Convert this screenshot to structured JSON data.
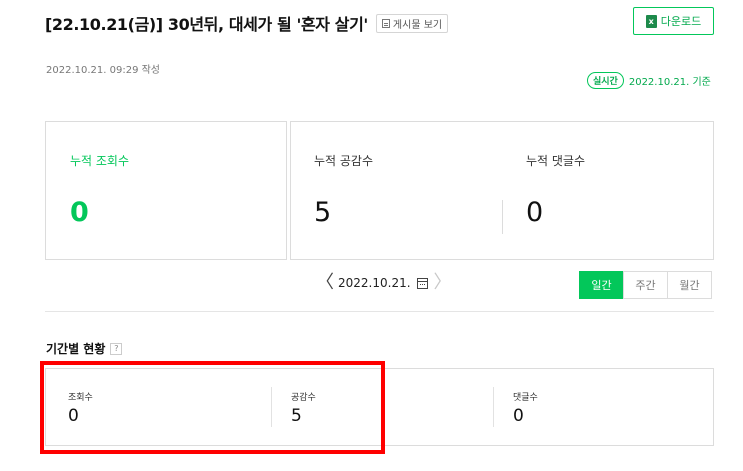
{
  "header": {
    "title": "[22.10.21(금)] 30년뒤, 대세가 될 '혼자 살기'",
    "view_post_label": "게시물 보기",
    "download_label": "다운로드",
    "excel_icon_text": "x"
  },
  "meta": {
    "written_date": "2022.10.21. 09:29 작성",
    "realtime_badge": "실시간",
    "basis_date": "2022.10.21. 기준"
  },
  "summary": {
    "views_label": "누적 조회수",
    "views_value": "0",
    "likes_label": "누적 공감수",
    "likes_value": "5",
    "comments_label": "누적 댓글수",
    "comments_value": "0"
  },
  "date_nav": {
    "prev": "〈",
    "date": "2022.10.21.",
    "next": "〉"
  },
  "period_tabs": [
    "일간",
    "주간",
    "월간"
  ],
  "period_section": {
    "title": "기간별 현황",
    "help": "?",
    "items": [
      {
        "label": "조회수",
        "value": "0"
      },
      {
        "label": "공감수",
        "value": "5"
      },
      {
        "label": "댓글수",
        "value": "0"
      }
    ]
  },
  "colors": {
    "accent": "#03c75a",
    "highlight": "#ff0000"
  }
}
